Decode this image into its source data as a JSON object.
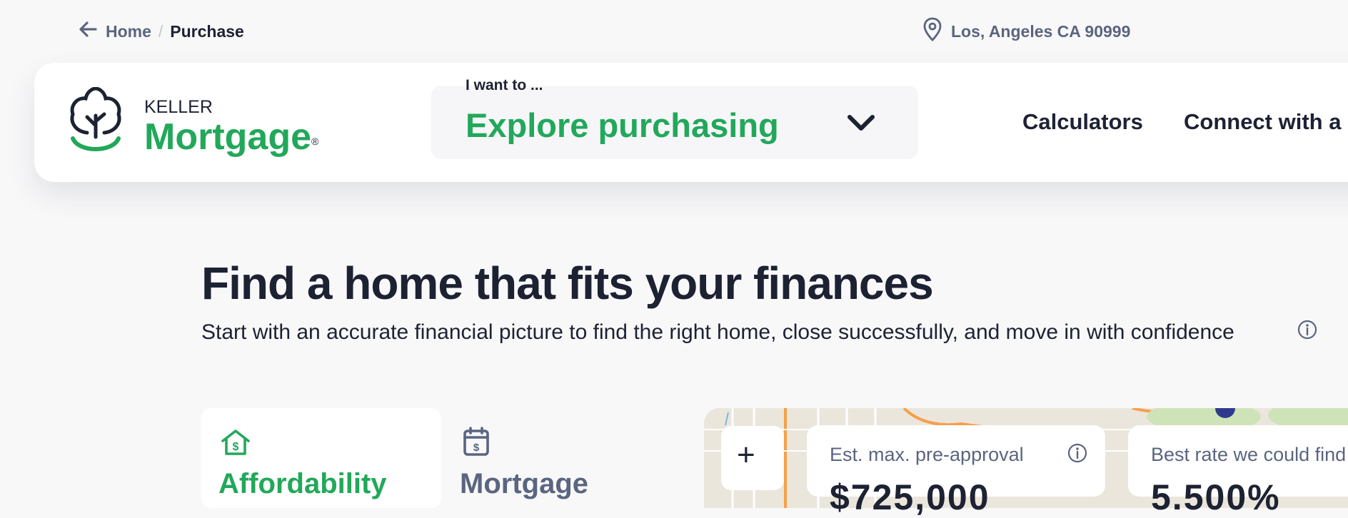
{
  "breadcrumb": {
    "home": "Home",
    "separator": "/",
    "current": "Purchase"
  },
  "location": {
    "text": "Los, Angeles CA 90999"
  },
  "logo": {
    "keller": "KELLER",
    "mortgage": "Mortgage",
    "registered": "®"
  },
  "intent": {
    "label": "I want to ...",
    "value": "Explore purchasing"
  },
  "nav": {
    "calculators": "Calculators",
    "connect": "Connect with a l"
  },
  "hero": {
    "title": "Find a home that fits your finances",
    "subtitle": "Start with an accurate financial picture to find the right home, close successfully, and move in with confidence"
  },
  "tabs": [
    {
      "label": "Affordability",
      "icon": "house-dollar-icon"
    },
    {
      "label": "Mortgage",
      "icon": "calendar-dollar-icon"
    }
  ],
  "map": {
    "zoom_in": "+"
  },
  "stats": {
    "preapproval_label": "Est. max. pre-approval",
    "preapproval_value": "$725,000",
    "rate_label": "Best rate we could find",
    "rate_value": "5.500%"
  },
  "colors": {
    "brand_green": "#22a85a",
    "navy": "#1d2233",
    "slate": "#5b6580"
  }
}
